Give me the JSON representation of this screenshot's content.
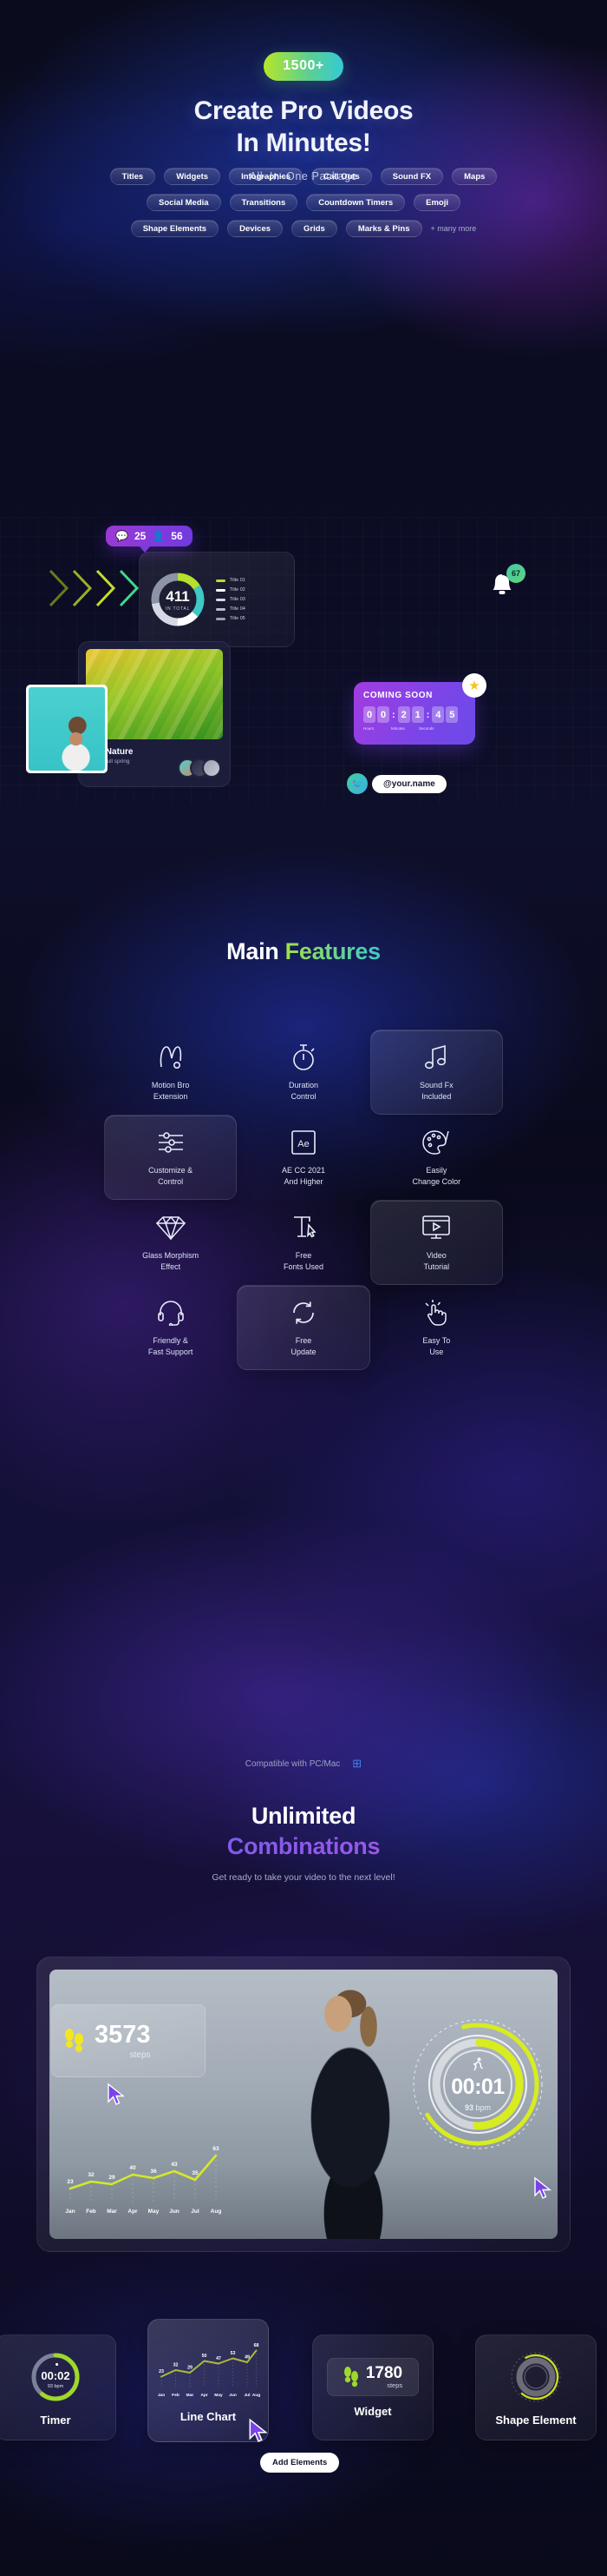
{
  "hero": {
    "badge": "1500+",
    "title_line1": "Create Pro Videos",
    "title_line2": "In Minutes!",
    "subtitle": "All–In–One Package",
    "badge_gradient_from": "#b6e62b",
    "badge_gradient_to": "#34c9d6"
  },
  "pills": {
    "row1": [
      "Titles",
      "Widgets",
      "Infographics",
      "Call Outs",
      "Sound FX",
      "Maps"
    ],
    "row2": [
      "Social Media",
      "Transitions",
      "Countdown Timers",
      "Emoji"
    ],
    "row3": [
      "Shape Elements",
      "Devices",
      "Grids",
      "Marks & Pins"
    ],
    "more": "+ many more"
  },
  "collage": {
    "bubble": {
      "comments": "25",
      "views": "56"
    },
    "bell_badge": "67",
    "star": "★",
    "donut": {
      "value": "411",
      "label": "IN TOTAL"
    },
    "legend": [
      {
        "label": "Title 01",
        "color": "#b6e02e"
      },
      {
        "label": "Title 02",
        "color": "#ffffff"
      },
      {
        "label": "Title 03",
        "color": "#d5d9e6"
      },
      {
        "label": "Title 04",
        "color": "#b9bfd0"
      },
      {
        "label": "Title 05",
        "color": "#9aa0b4"
      }
    ],
    "nature_card": {
      "title": "Like Nature",
      "subtitle": "Wonderfull spring"
    },
    "coming_soon": {
      "heading": "COMING SOON",
      "digits": [
        "0",
        "0",
        "2",
        "1",
        "4",
        "5"
      ],
      "sep": ":",
      "labels": [
        "Hours",
        "Minutes",
        "Seconds"
      ]
    },
    "twitter": {
      "handle": "@your.name",
      "icon": "🐦"
    }
  },
  "features_section": {
    "title_part1": "Main ",
    "title_part2": "Features",
    "items": [
      {
        "label_line1": "Motion Bro",
        "label_line2": "Extension",
        "icon": "motion-bro-icon",
        "highlight": false
      },
      {
        "label_line1": "Duration",
        "label_line2": "Control",
        "icon": "stopwatch-icon",
        "highlight": false
      },
      {
        "label_line1": "Sound Fx",
        "label_line2": "Included",
        "icon": "music-note-icon",
        "highlight": true
      },
      {
        "label_line1": "Customize &",
        "label_line2": "Control",
        "icon": "sliders-icon",
        "highlight": true
      },
      {
        "label_line1": "AE CC 2021",
        "label_line2": "And Higher",
        "icon": "after-effects-icon",
        "highlight": false
      },
      {
        "label_line1": "Easily",
        "label_line2": "Change Color",
        "icon": "palette-icon",
        "highlight": false
      },
      {
        "label_line1": "Glass Morphism",
        "label_line2": "Effect",
        "icon": "diamond-icon",
        "highlight": false
      },
      {
        "label_line1": "Free",
        "label_line2": "Fonts Used",
        "icon": "text-cursor-icon",
        "highlight": false
      },
      {
        "label_line1": "Video",
        "label_line2": "Tutorial",
        "icon": "video-play-icon",
        "highlight": true
      },
      {
        "label_line1": "Friendly &",
        "label_line2": "Fast Support",
        "icon": "headset-icon",
        "highlight": false
      },
      {
        "label_line1": "Free",
        "label_line2": "Update",
        "icon": "refresh-icon",
        "highlight": true
      },
      {
        "label_line1": "Easy To",
        "label_line2": "Use",
        "icon": "click-hand-icon",
        "highlight": false
      }
    ],
    "compatible_text": "Compatible with PC/Mac",
    "apple_icon": "",
    "windows_icon": "⊞"
  },
  "combinations_section": {
    "title_line1": "Unlimited",
    "title_line2": "Combinations",
    "subtitle": "Get ready to take your video to the next level!"
  },
  "video_preview": {
    "steps": {
      "value": "3573",
      "label": "steps",
      "icon": "footsteps-icon"
    },
    "timer": {
      "value": "00:01",
      "bpm_value": "93",
      "bpm_label": "bpm",
      "icon": "runner-icon"
    }
  },
  "toolbar": {
    "items": [
      {
        "label": "Timer",
        "active": false,
        "preview": {
          "time": "00:02",
          "bpm_value": "93",
          "bpm_label": "bpm"
        }
      },
      {
        "label": "Line Chart",
        "active": true
      },
      {
        "label": "Widget",
        "active": false,
        "preview": {
          "value": "1780",
          "label": "steps"
        }
      },
      {
        "label": "Shape Element",
        "active": false
      }
    ],
    "tooltip": "Add Elements"
  },
  "chart_data": [
    {
      "type": "line",
      "name": "video-overlay-line-chart",
      "categories": [
        "Jan",
        "Feb",
        "Mar",
        "Apr",
        "May",
        "Jun",
        "Jul",
        "Aug"
      ],
      "values": [
        23,
        32,
        29,
        40,
        36,
        43,
        35,
        63
      ],
      "title": "",
      "xlabel": "",
      "ylabel": "",
      "ylim": [
        0,
        70
      ],
      "grid": false,
      "legend": "none",
      "line_color": "#d4e82a",
      "data_labels": true
    },
    {
      "type": "line",
      "name": "toolbar-line-chart-card",
      "categories": [
        "Jan",
        "Feb",
        "Mar",
        "Apr",
        "May",
        "Jun",
        "Jul",
        "Aug"
      ],
      "values": [
        23,
        32,
        29,
        50,
        47,
        53,
        49,
        68
      ],
      "title": "Line Chart",
      "xlabel": "",
      "ylabel": "",
      "ylim": [
        0,
        75
      ],
      "grid": false,
      "legend": "none",
      "line_color": "#aeb93b",
      "data_labels": true
    },
    {
      "type": "pie",
      "name": "collage-donut-chart",
      "labels": [
        "Title 01",
        "Title 02",
        "Title 03",
        "Title 04",
        "Title 05"
      ],
      "values": [
        16,
        20,
        14,
        22,
        28
      ],
      "colors": [
        "#b6e02e",
        "#3ec9c5",
        "#ffffff",
        "#d5d9e6",
        "#8d94a8"
      ],
      "center_value": "411",
      "center_label": "IN TOTAL",
      "legend": "right"
    }
  ]
}
